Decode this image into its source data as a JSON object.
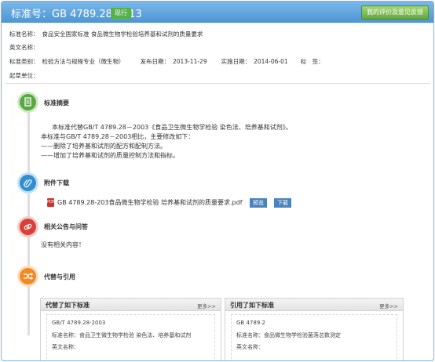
{
  "header": {
    "title": "标准号：GB 4789.28-2013",
    "status": "现行",
    "feedback": "我的评价及意见反馈"
  },
  "meta": {
    "cn_name_label": "标准名称：",
    "cn_name": "食品安全国家标准 食品微生物学检验培养基和试剂的质量要求",
    "en_name_label": "英文名称：",
    "category_label": "标准类别：",
    "category": "检验方法与规程专业（微生物）",
    "pub_label": "发布日期：",
    "pub_date": "2013-11-29",
    "impl_label": "实施日期：",
    "impl_date": "2014-06-01",
    "tag_label": "标　签：",
    "drafter_label": "起草单位："
  },
  "sections": {
    "abstract": "标准摘要",
    "attachment": "附件下载",
    "notices": "相关公告与问答",
    "replace": "代替与引用"
  },
  "abstract": {
    "l1": "本标准代替GB/T 4789.28－2003《食品卫生微生物学检验 染色法、培养基和试剂》。",
    "l2": "本标准与GB/T 4789.28－2003相比，主要修改如下：",
    "l3": "——删除了培养基和试剂的配方和配制方法。",
    "l4": "——增加了培养基和试剂的质量控制方法和指标。"
  },
  "attachment": {
    "icon": "pdf-icon",
    "filename": "GB 4789.28-203食品微生物学检验 培养基和试剂的质量要求.pdf",
    "preview": "预览",
    "download": "下载"
  },
  "notices": {
    "empty": "没有相关内容！"
  },
  "replaced_box": {
    "title": "代替了如下标准",
    "more": "更多>>",
    "code": "GB/T 4789.28-2003",
    "name_label": "标准名称：",
    "name": "食品卫生微生物学检验 染色法、培养基和试剂",
    "en_label": "英文名称："
  },
  "cited_box": {
    "title": "引用了如下标准",
    "more": "更多>>",
    "code": "GB 4789.2",
    "name_label": "标准名称：",
    "name": "食品微生物学检验菌落总数测定",
    "en_label": "英文名称："
  },
  "colors": {
    "header": "#4d95d3",
    "status_badge": "#56b04c",
    "abstract_icon": "#5aa843",
    "attachment_icon": "#2f8fd0",
    "notices_icon": "#d9403a",
    "replace_icon": "#f08a24",
    "button": "#4a82bd"
  },
  "icons": {
    "abstract": "document-icon",
    "attachment": "paperclip-icon",
    "notices": "link-icon",
    "replace": "shuffle-icon"
  }
}
